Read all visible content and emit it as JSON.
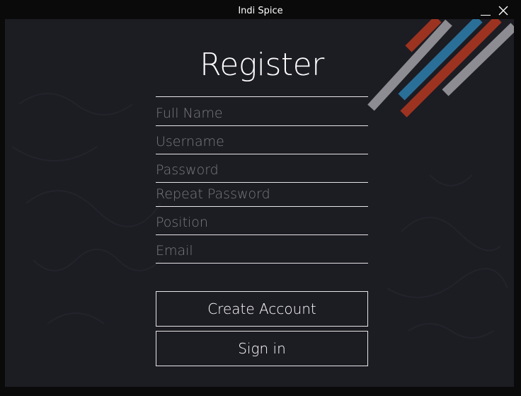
{
  "window": {
    "title": "Indi Spice",
    "controls": {
      "minimize_icon": "minimize-icon",
      "close_icon": "close-icon"
    }
  },
  "form": {
    "heading": "Register",
    "fields": [
      {
        "name": "full-name",
        "placeholder": "Full Name",
        "value": ""
      },
      {
        "name": "username",
        "placeholder": "Username",
        "value": ""
      },
      {
        "name": "password",
        "placeholder": "Password",
        "value": ""
      },
      {
        "name": "repeat-password",
        "placeholder": "Repeat Password",
        "value": ""
      },
      {
        "name": "position",
        "placeholder": "Position",
        "value": ""
      },
      {
        "name": "email",
        "placeholder": "Email",
        "value": ""
      }
    ],
    "create_account_label": "Create Account",
    "sign_in_label": "Sign in"
  },
  "colors": {
    "window_frame": "#0a0a0a",
    "background": "#1c1c23",
    "text": "#ffffff",
    "placeholder": "#7a7a80",
    "stripe_red": "#9c3320",
    "stripe_blue": "#2a6f97",
    "stripe_gray": "#8c8c92"
  }
}
